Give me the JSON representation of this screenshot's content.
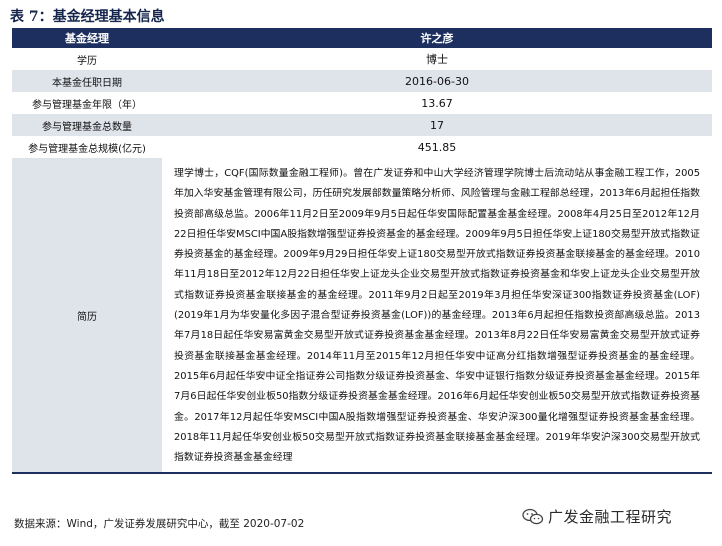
{
  "title": "表 7：基金经理基本信息",
  "header": {
    "col1": "基金经理",
    "col2": "许之彦"
  },
  "rows": [
    {
      "label": "学历",
      "value": "博士"
    },
    {
      "label": "本基金任职日期",
      "value": "2016-06-30"
    },
    {
      "label": "参与管理基金年限（年）",
      "value": "13.67"
    },
    {
      "label": "参与管理基金总数量",
      "value": "17"
    },
    {
      "label": "参与管理基金总规模(亿元)",
      "value": "451.85"
    }
  ],
  "bio": {
    "label": "简历",
    "text": "理学博士，CQF(国际数量金融工程师)。曾在广发证券和中山大学经济管理学院博士后流动站从事金融工程工作，2005年加入华安基金管理有限公司，历任研究发展部数量策略分析师、风险管理与金融工程部总经理，2013年6月起担任指数投资部高级总监。2006年11月2日至2009年9月5日起任华安国际配置基金基金经理。2008年4月25日至2012年12月22日担任华安MSCI中国A股指数增强型证券投资基金的基金经理。2009年9月5日担任华安上证180交易型开放式指数证券投资基金的基金经理。2009年9月29日担任华安上证180交易型开放式指数证券投资基金联接基金的基金经理。2010年11月18日至2012年12月22日担任华安上证龙头企业交易型开放式指数证券投资基金和华安上证龙头企业交易型开放式指数证券投资基金联接基金的基金经理。2011年9月2日起至2019年3月担任华安深证300指数证券投资基金(LOF)(2019年1月为华安量化多因子混合型证券投资基金(LOF))的基金经理。2013年6月起担任指数投资部高级总监。2013年7月18日起任华安易富黄金交易型开放式证券投资基金基金经理。2013年8月22日任华安易富黄金交易型开放式证券投资基金联接基金基金经理。2014年11月至2015年12月担任华安中证高分红指数增强型证券投资基金的基金经理。2015年6月起任华安中证全指证券公司指数分级证券投资基金、华安中证银行指数分级证券投资基金基金经理。2015年7月6日起任华安创业板50指数分级证券投资基金基金经理。2016年6月起任华安创业板50交易型开放式指数证券投资基金。2017年12月起任华安MSCI中国A股指数增强型证券投资基金、华安沪深300量化增强型证券投资基金基金经理。2018年11月起任华安创业板50交易型开放式指数证券投资基金联接基金基金经理。2019年华安沪深300交易型开放式指数证券投资基金基金经理"
  },
  "source": "数据来源：Wind，广发证券发展研究中心，截至 2020-07-02",
  "logo": {
    "text": "广发金融工程研究",
    "icon": "wechat-icon"
  },
  "colors": {
    "header_bg": "#1c2f5f",
    "title": "#15254c",
    "stripe": "#dfe3ea"
  }
}
